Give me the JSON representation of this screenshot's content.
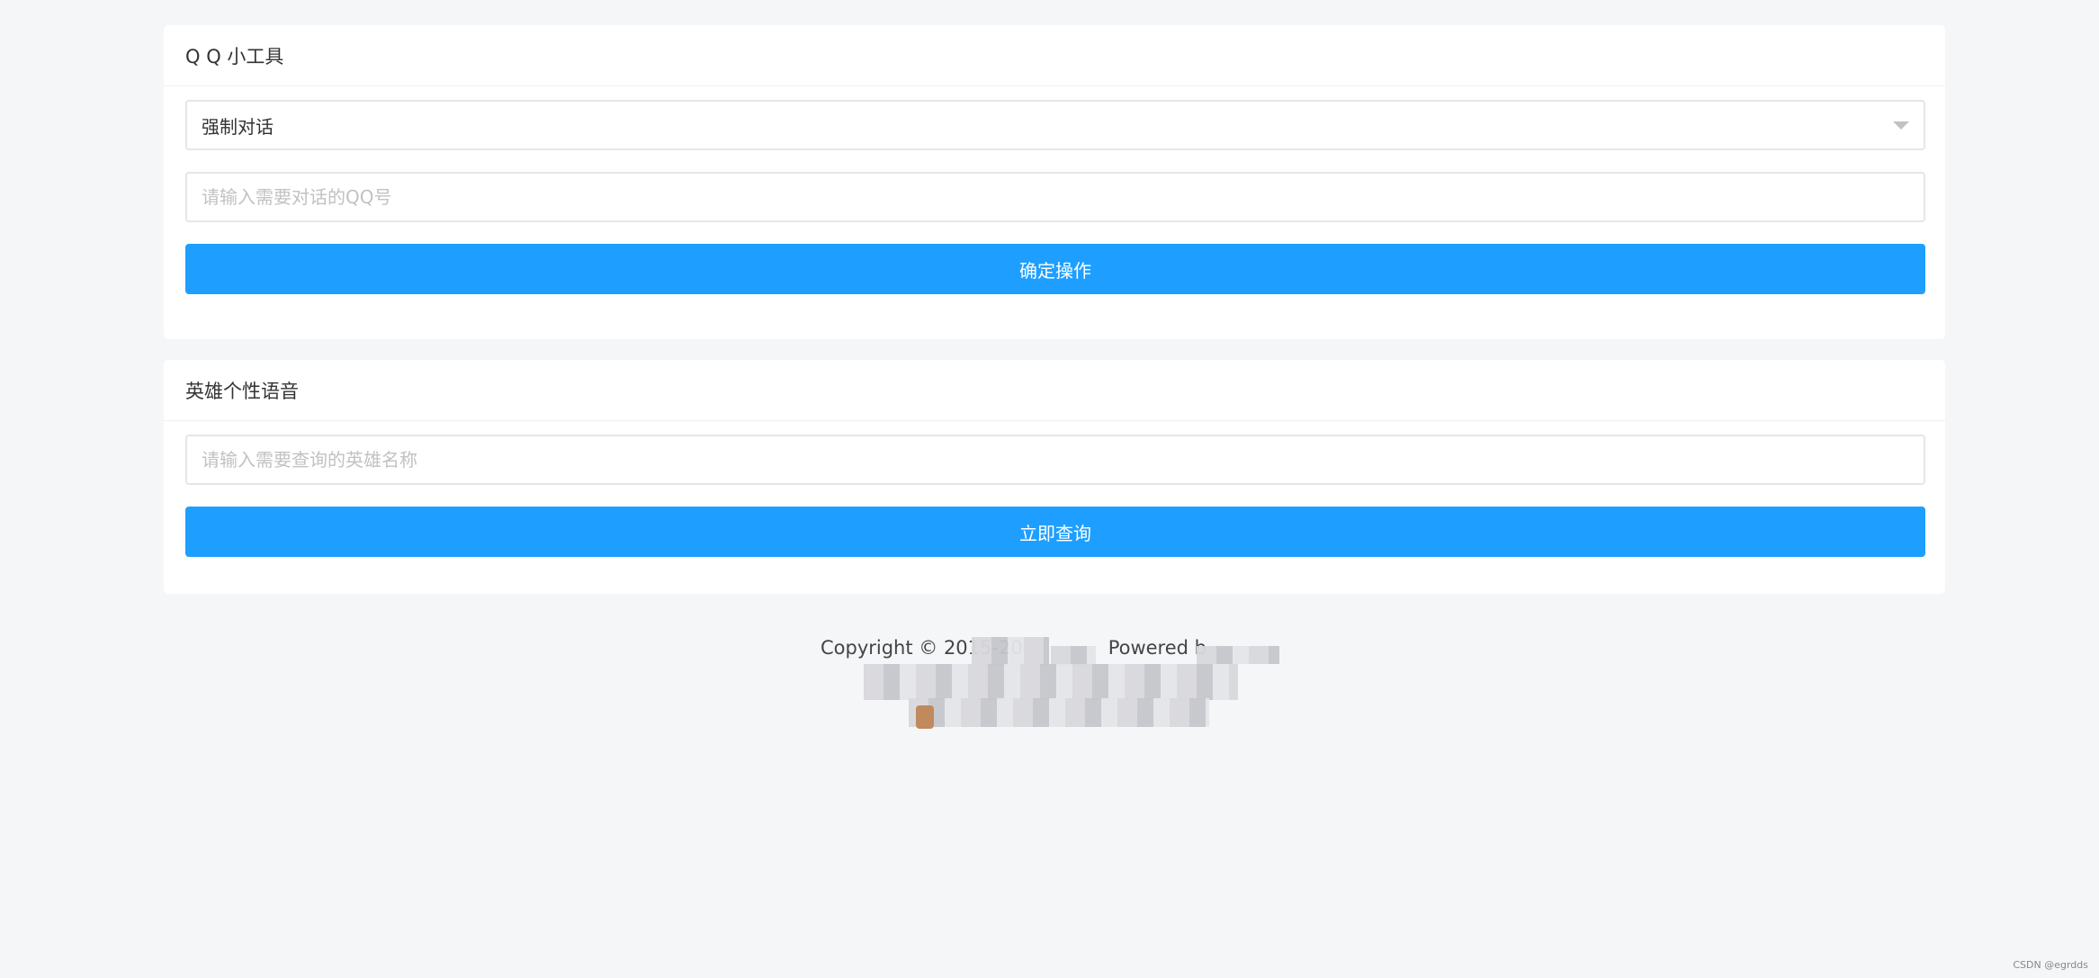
{
  "qq_tools": {
    "title": "Q Q 小工具",
    "select_value": "强制对话",
    "qq_placeholder": "请输入需要对话的QQ号",
    "confirm_label": "确定操作"
  },
  "hero_voice": {
    "title": "英雄个性语音",
    "hero_placeholder": "请输入需要查询的英雄名称",
    "query_label": "立即查询"
  },
  "footer": {
    "copyright": "Copyright © 2015-20",
    "powered": "Powered b"
  },
  "watermark": "CSDN @egrdds"
}
